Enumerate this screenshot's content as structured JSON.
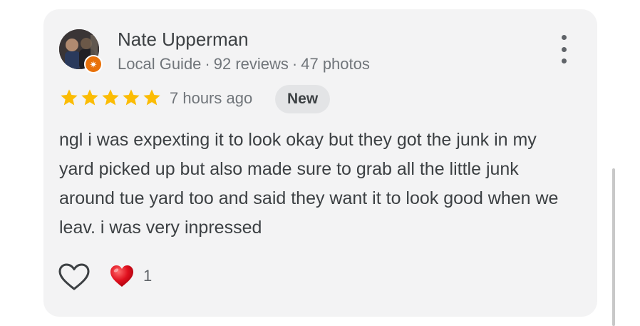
{
  "reviewer": {
    "name": "Nate Upperman",
    "role": "Local Guide",
    "reviews": "92 reviews",
    "photos": "47 photos",
    "separator": "·"
  },
  "rating": {
    "stars": 5,
    "max": 5,
    "star_color": "#fbbc04"
  },
  "time_ago": "7 hours ago",
  "badge": "New",
  "review_text": "ngl i was expexting it to look okay but they got the junk in my yard picked up but also made sure to grab all the little junk around tue yard too and said they want it to look good when we leav. i was very inpressed",
  "reactions": {
    "like_icon": "heart-outline-icon",
    "reaction_icon": "red-heart-icon",
    "reaction_count": "1"
  },
  "icons": {
    "more": "more-vert-icon",
    "guide_badge": "local-guide-star-icon"
  }
}
